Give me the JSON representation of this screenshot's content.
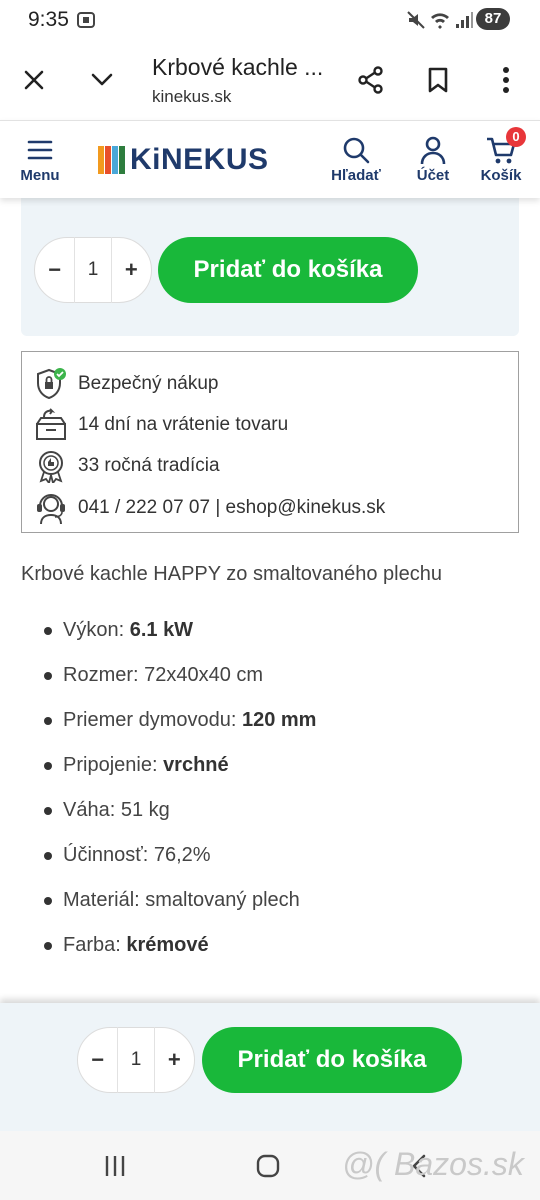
{
  "status_bar": {
    "time": "9:35",
    "battery": "87"
  },
  "browser": {
    "title": "Krbové kachle ...",
    "url": "kinekus.sk"
  },
  "header": {
    "menu_label": "Menu",
    "logo_text": "KiNEKUS",
    "search_label": "Hľadať",
    "account_label": "Účet",
    "cart_label": "Košík",
    "cart_count": "0"
  },
  "buy_panel": {
    "minus": "−",
    "quantity": "1",
    "plus": "+",
    "add_to_cart": "Pridať do košíka"
  },
  "features": [
    {
      "icon": "secure-shopping-icon",
      "text": "Bezpečný nákup"
    },
    {
      "icon": "return-box-icon",
      "text": "14 dní na vrátenie tovaru"
    },
    {
      "icon": "tradition-badge-icon",
      "text": "33 ročná tradícia"
    },
    {
      "icon": "support-headset-icon",
      "text": "041 / 222 07 07 | eshop@kinekus.sk"
    }
  ],
  "description": {
    "title": "Krbové kachle HAPPY zo smaltovaného plechu",
    "specs": [
      {
        "label": "Výkon: ",
        "value": "6.1 kW",
        "bold": true
      },
      {
        "label": "Rozmer: ",
        "value": "72x40x40 cm",
        "bold": false
      },
      {
        "label": "Priemer dymovodu: ",
        "value": "120 mm",
        "bold": true
      },
      {
        "label": "Pripojenie: ",
        "value": "vrchné",
        "bold": true
      },
      {
        "label": "Váha: ",
        "value": "51 kg",
        "bold": false
      },
      {
        "label": "Účinnosť: ",
        "value": "76,2%",
        "bold": false
      },
      {
        "label": "Materiál: ",
        "value": "smaltovaný plech",
        "bold": false
      },
      {
        "label": "Farba: ",
        "value": "krémové",
        "bold": true
      }
    ]
  },
  "sticky_bar": {
    "minus": "−",
    "quantity": "1",
    "plus": "+",
    "add_to_cart": "Pridať do košíka"
  },
  "watermark": "@( Bazos.sk",
  "colors": {
    "brand_blue": "#1f3a6b",
    "cta_green": "#19b83a",
    "panel_bg": "#eef4f8",
    "badge_red": "#e8363a"
  }
}
